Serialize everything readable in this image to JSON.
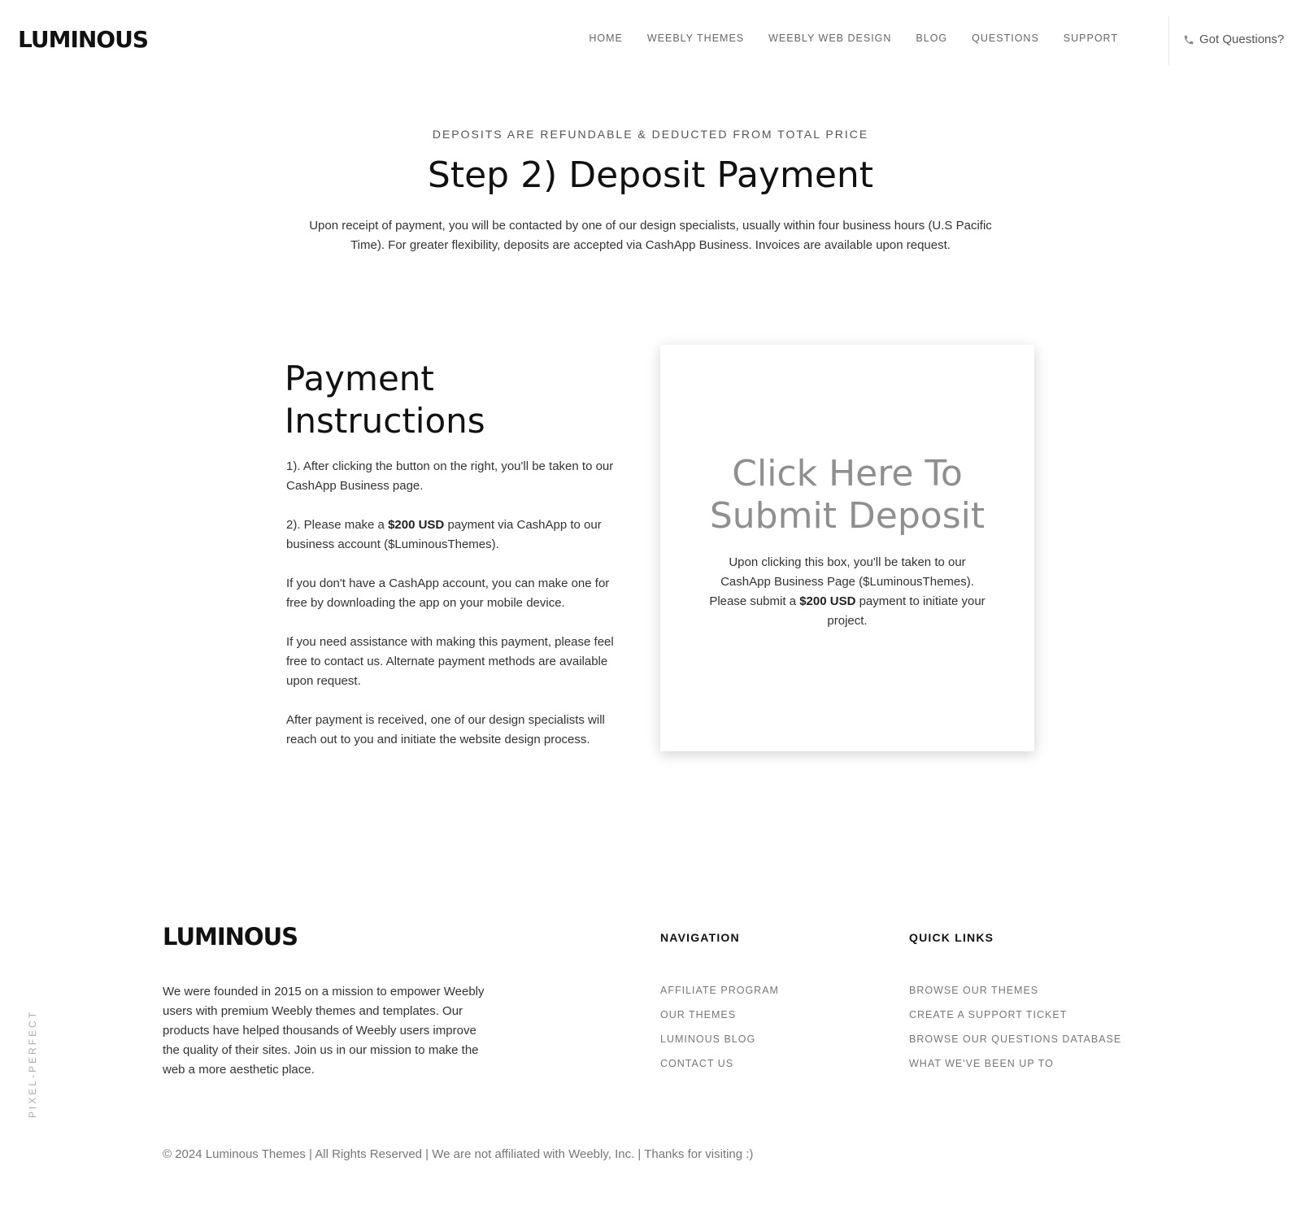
{
  "header": {
    "logo": "LUMINOUS",
    "nav": [
      "HOME",
      "WEEBLY THEMES",
      "WEEBLY WEB DESIGN",
      "BLOG",
      "QUESTIONS",
      "SUPPORT"
    ],
    "phone_label": "Got Questions?",
    "phone_icon": "phone-icon"
  },
  "hero": {
    "eyebrow": "DEPOSITS ARE REFUNDABLE & DEDUCTED FROM TOTAL PRICE",
    "title": "Step 2) Deposit Payment",
    "description": "Upon receipt of payment, you will be contacted by one of our design specialists, usually within four business hours (U.S Pacific Time). For greater flexibility, deposits are accepted via CashApp Business. Invoices are available upon request."
  },
  "instructions": {
    "title_line1": "Payment",
    "title_line2": "Instructions",
    "p1": "1). After clicking the button on the right, you'll be taken to our CashApp Business page.",
    "p2_pre": "2). Please make a ",
    "p2_bold": "$200 USD",
    "p2_post": " payment via CashApp to our business account ($LuminousThemes).",
    "p3": "If you don't have a CashApp account, you can make one for free by downloading the app on your mobile device.",
    "p4": "If you need assistance with making this payment, please feel free to contact us. Alternate payment methods are available upon request.",
    "p5": "After payment is received, one of our design specialists will reach out to you and initiate the website design process."
  },
  "card": {
    "title_line1": "Click Here To",
    "title_line2": "Submit Deposit",
    "text_pre": "Upon clicking this box, you'll be taken to our CashApp Business Page ($LuminousThemes). Please submit a ",
    "text_bold": "$200 USD",
    "text_post": " payment to initiate your project."
  },
  "footer": {
    "logo": "LUMINOUS",
    "about": "We were founded in 2015 on a mission to empower Weebly users with premium Weebly themes and templates. Our products have helped thousands of Weebly users improve the quality of their sites. Join us in our mission to make the web a more aesthetic place.",
    "nav_heading": "NAVIGATION",
    "nav_links": [
      "AFFILIATE PROGRAM",
      "OUR THEMES",
      "LUMINOUS BLOG",
      "CONTACT US"
    ],
    "quick_heading": "QUICK LINKS",
    "quick_links": [
      "BROWSE OUR THEMES",
      "CREATE A SUPPORT TICKET",
      "BROWSE OUR QUESTIONS DATABASE",
      "WHAT WE'VE BEEN UP TO"
    ],
    "side_text": "PIXEL-PERFECT",
    "copyright": "© 2024 Luminous Themes | All Rights Reserved | We are not affiliated with Weebly, Inc. | Thanks for visiting :)"
  },
  "colors": {
    "text": "#333333",
    "heading": "#111111",
    "card_title": "#8f8f8f",
    "link": "#777777"
  }
}
